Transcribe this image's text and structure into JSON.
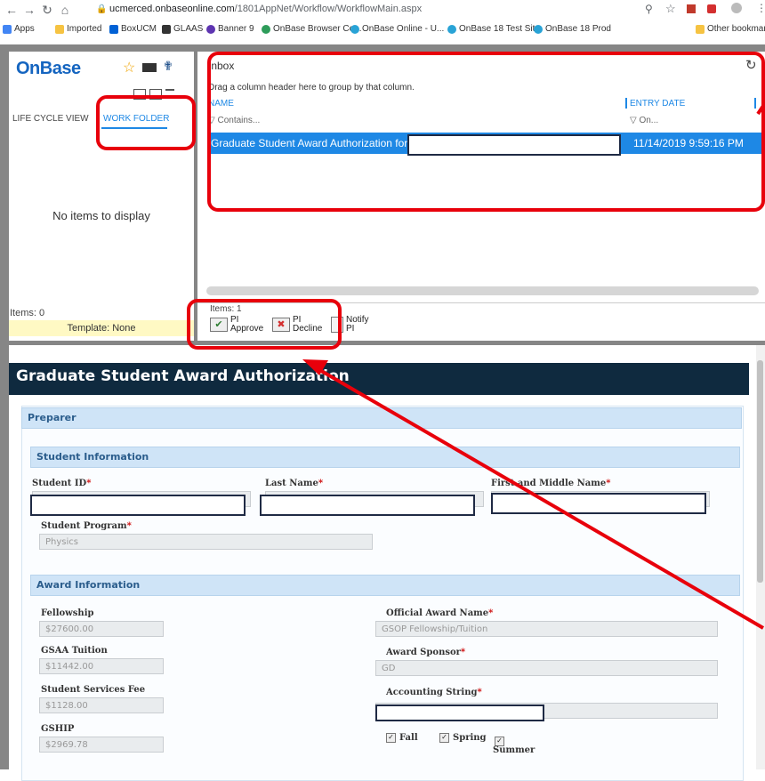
{
  "browser": {
    "url_host": "ucmerced.onbaseonline.com",
    "url_path": "/1801AppNet/Workflow/WorkflowMain.aspx",
    "bookmarks": [
      "Apps",
      "Imported",
      "BoxUCM",
      "GLAAS",
      "Banner 9",
      "OnBase Browser Co...",
      "OnBase Online - U...",
      "OnBase 18 Test Site",
      "OnBase 18 Prod"
    ],
    "other_bookmarks": "Other bookmarks"
  },
  "left": {
    "logo": "OnBase",
    "tab_lifecycle": "LIFE CYCLE VIEW",
    "tab_workfolder": "WORK FOLDER",
    "empty": "No items to display",
    "items": "Items: 0",
    "template": "Template: None"
  },
  "inbox": {
    "title": "Inbox",
    "group_hint": "Drag a column header here to group by that column.",
    "col_name": "NAME",
    "col_date": "ENTRY DATE",
    "filter_name": "Contains...",
    "filter_date": "On...",
    "row_name": "Graduate Student Award Authorization for",
    "row_date": "11/14/2019 9:59:16 PM",
    "items": "Items: 1",
    "btn_approve": "PI Approve",
    "btn_decline": "PI Decline",
    "btn_notify": "Notify PI"
  },
  "form": {
    "title": "Graduate Student Award Authorization",
    "preparer": "Preparer",
    "student_info": "Student Information",
    "student_id": "Student ID",
    "last_name": "Last Name",
    "first_middle": "First and Middle Name",
    "student_program": "Student Program",
    "student_program_value": "Physics",
    "award_info": "Award Information",
    "fellowship": "Fellowship",
    "fellowship_value": "$27600.00",
    "gsaa_tuition": "GSAA Tuition",
    "gsaa_tuition_value": "$11442.00",
    "ssf": "Student Services Fee",
    "ssf_value": "$1128.00",
    "gship": "GSHIP",
    "gship_value": "$2969.78",
    "official_award_name": "Official Award Name",
    "official_award_name_value": "GSOP Fellowship/Tuition",
    "award_sponsor": "Award Sponsor",
    "award_sponsor_value": "GD",
    "accounting_string": "Accounting String",
    "term_fall": "Fall",
    "term_spring": "Spring",
    "term_summer": "Summer"
  },
  "colors": {
    "accent_blue": "#1e88e5",
    "selection": "#1e88e5",
    "form_header": "#0f2a3f",
    "annotation_red": "#e8000b"
  }
}
